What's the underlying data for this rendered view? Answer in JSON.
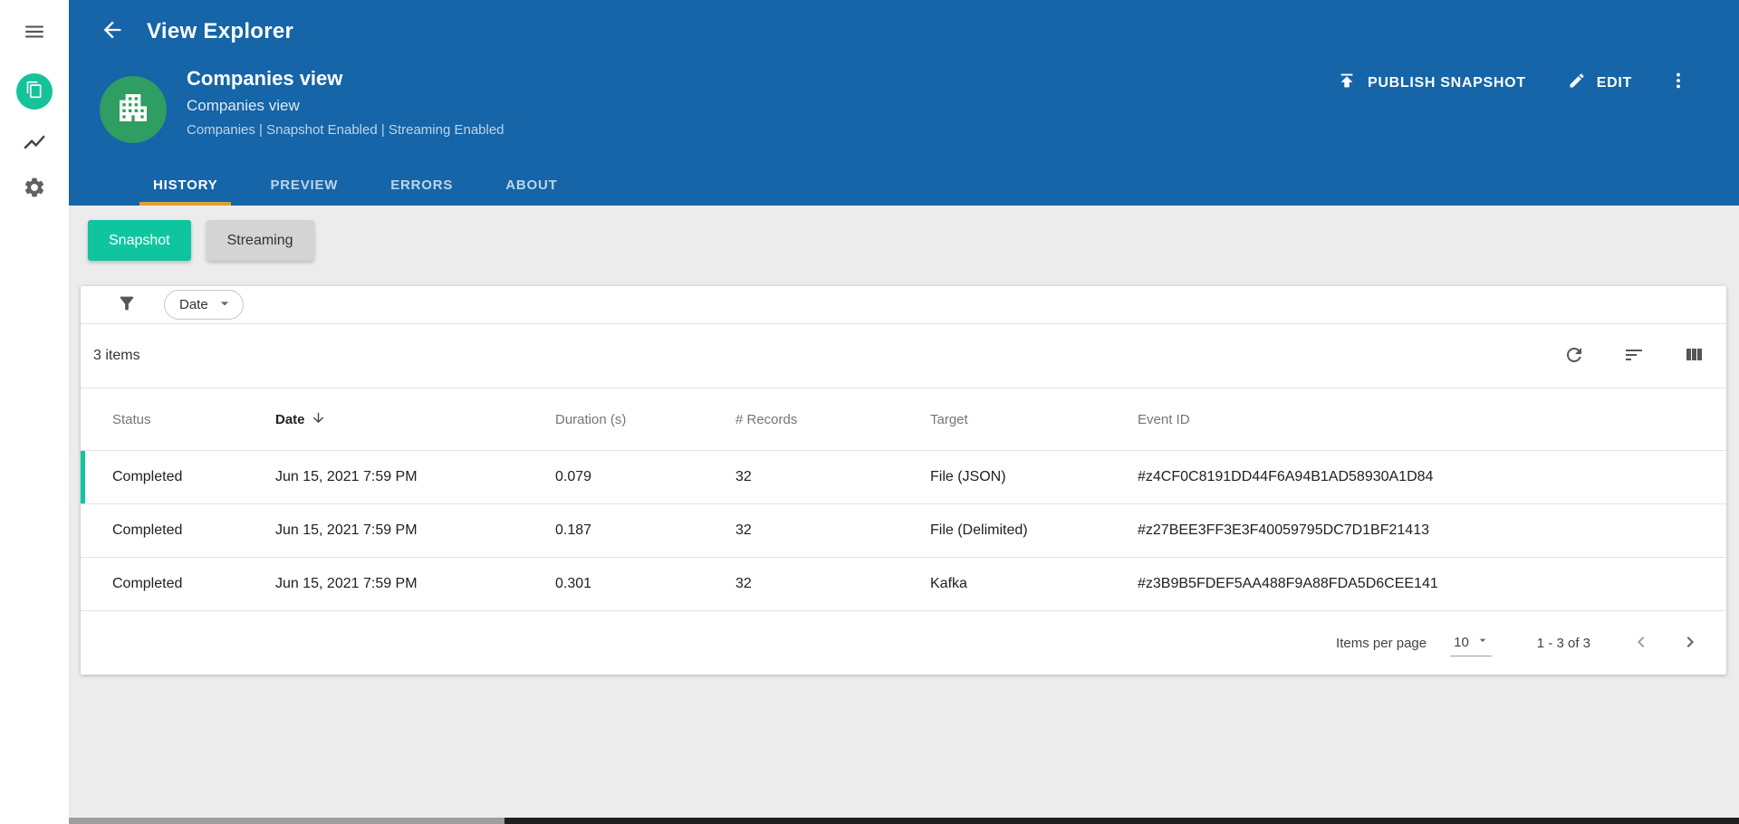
{
  "colors": {
    "header_blue": "#1565a8",
    "accent_teal": "#0fc5a0",
    "tab_underline": "#dfa131",
    "avatar_green": "#2e9e62",
    "logo_teal": "#15c39a"
  },
  "icons": {
    "sidebar": [
      "menu-icon",
      "pages-logo-icon",
      "line-chart-icon",
      "gear-icon"
    ],
    "header": [
      "back-arrow-icon",
      "building-icon",
      "upload-icon",
      "pencil-icon",
      "kebab-menu-icon"
    ],
    "card": [
      "filter-funnel-icon",
      "caret-down-icon",
      "refresh-icon",
      "sort-icon",
      "columns-icon",
      "arrow-down-icon",
      "chevron-left-icon",
      "chevron-right-icon"
    ]
  },
  "topbar": {
    "title": "View Explorer"
  },
  "view": {
    "title": "Companies view",
    "subtitle": "Companies view",
    "meta": "Companies | Snapshot Enabled | Streaming Enabled",
    "actions": {
      "publish": "PUBLISH SNAPSHOT",
      "edit": "EDIT"
    }
  },
  "tabs": [
    {
      "label": "HISTORY",
      "active": true
    },
    {
      "label": "PREVIEW",
      "active": false
    },
    {
      "label": "ERRORS",
      "active": false
    },
    {
      "label": "ABOUT",
      "active": false
    }
  ],
  "toggles": [
    {
      "label": "Snapshot",
      "active": true
    },
    {
      "label": "Streaming",
      "active": false
    }
  ],
  "filterbar": {
    "date_label": "Date"
  },
  "table": {
    "items_count": "3 items",
    "columns": [
      "Status",
      "Date",
      "Duration (s)",
      "# Records",
      "Target",
      "Event ID"
    ],
    "sorted_column": "Date",
    "sort_direction": "desc",
    "rows": [
      {
        "status": "Completed",
        "date": "Jun 15, 2021 7:59 PM",
        "duration": "0.079",
        "records": "32",
        "target": "File (JSON)",
        "event_id": "#z4CF0C8191DD44F6A94B1AD58930A1D84"
      },
      {
        "status": "Completed",
        "date": "Jun 15, 2021 7:59 PM",
        "duration": "0.187",
        "records": "32",
        "target": "File (Delimited)",
        "event_id": "#z27BEE3FF3E3F40059795DC7D1BF21413"
      },
      {
        "status": "Completed",
        "date": "Jun 15, 2021 7:59 PM",
        "duration": "0.301",
        "records": "32",
        "target": "Kafka",
        "event_id": "#z3B9B5FDEF5AA488F9A88FDA5D6CEE141"
      }
    ]
  },
  "pagination": {
    "items_per_page_label": "Items per page",
    "page_size": "10",
    "range": "1 - 3 of 3"
  }
}
